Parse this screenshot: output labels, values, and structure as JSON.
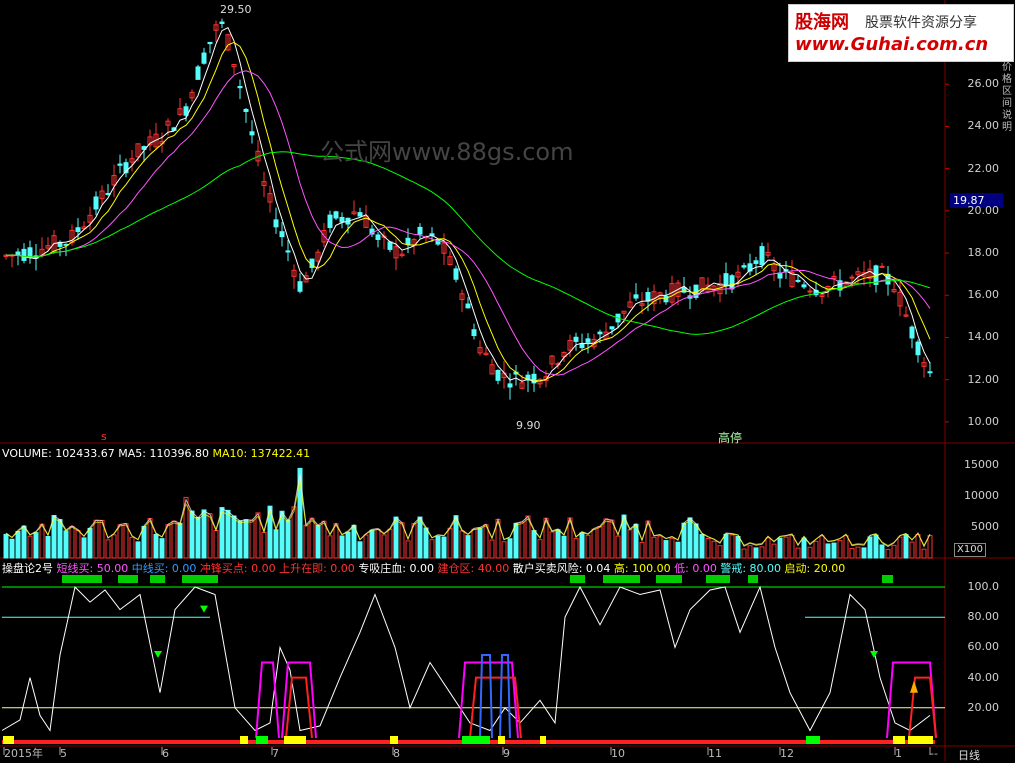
{
  "banner": {
    "brand": "股海网",
    "slogan": "股票软件资源分享",
    "url": "www.Guhai.com.cn"
  },
  "watermark": "公式网www.88gs.com",
  "price_panel": {
    "high_label": "29.50",
    "low_label": "9.90",
    "current_price": "19.87",
    "event_label": "高停",
    "signal_label": "s",
    "y_ticks": [
      "26.00",
      "24.00",
      "22.00",
      "20.00",
      "18.00",
      "16.00",
      "14.00",
      "12.00",
      "10.00"
    ],
    "side_text": "价格区间说明"
  },
  "volume_panel": {
    "header": [
      {
        "text": "VOLUME: 102433.67",
        "color": "#ffffff"
      },
      {
        "text": "MA5: 110396.80",
        "color": "#ffffff"
      },
      {
        "text": "MA10: 137422.41",
        "color": "#ffff00"
      }
    ],
    "y_ticks": [
      "15000",
      "10000",
      "5000"
    ],
    "unit": "X100"
  },
  "indicator_panel": {
    "header": [
      {
        "text": "操盘论2号",
        "color": "#ffffff"
      },
      {
        "text": "短线买: 50.00",
        "color": "#ff55ff"
      },
      {
        "text": "中线买: 0.00",
        "color": "#3399ff"
      },
      {
        "text": "冲锋买点: 0.00",
        "color": "#ff3333"
      },
      {
        "text": "上升在即: 0.00",
        "color": "#ff3333"
      },
      {
        "text": "专吸庄血: 0.00",
        "color": "#ffffff"
      },
      {
        "text": "建仓区: 40.00",
        "color": "#ff3333"
      },
      {
        "text": "散户买卖风险: 0.04",
        "color": "#ffffff"
      },
      {
        "text": "高: 100.00",
        "color": "#ffff00"
      },
      {
        "text": "低: 0.00",
        "color": "#ff55ff"
      },
      {
        "text": "警戒: 80.00",
        "color": "#55ffff"
      },
      {
        "text": "启动: 20.00",
        "color": "#ffff00"
      }
    ],
    "y_ticks": [
      "100.0",
      "80.00",
      "60.00",
      "40.00",
      "20.00"
    ]
  },
  "time_axis": {
    "labels": [
      "2015年",
      "5",
      "6",
      "7",
      "8",
      "9",
      "10",
      "11",
      "12",
      "1",
      "--"
    ],
    "period": "日线"
  },
  "colors": {
    "up": "#ff3232",
    "down": "#54fcfc",
    "ma5": "#ffffff",
    "ma10": "#ffff00",
    "ma20": "#ff55ff",
    "ma60": "#00ff00",
    "grid": "#800000"
  }
}
